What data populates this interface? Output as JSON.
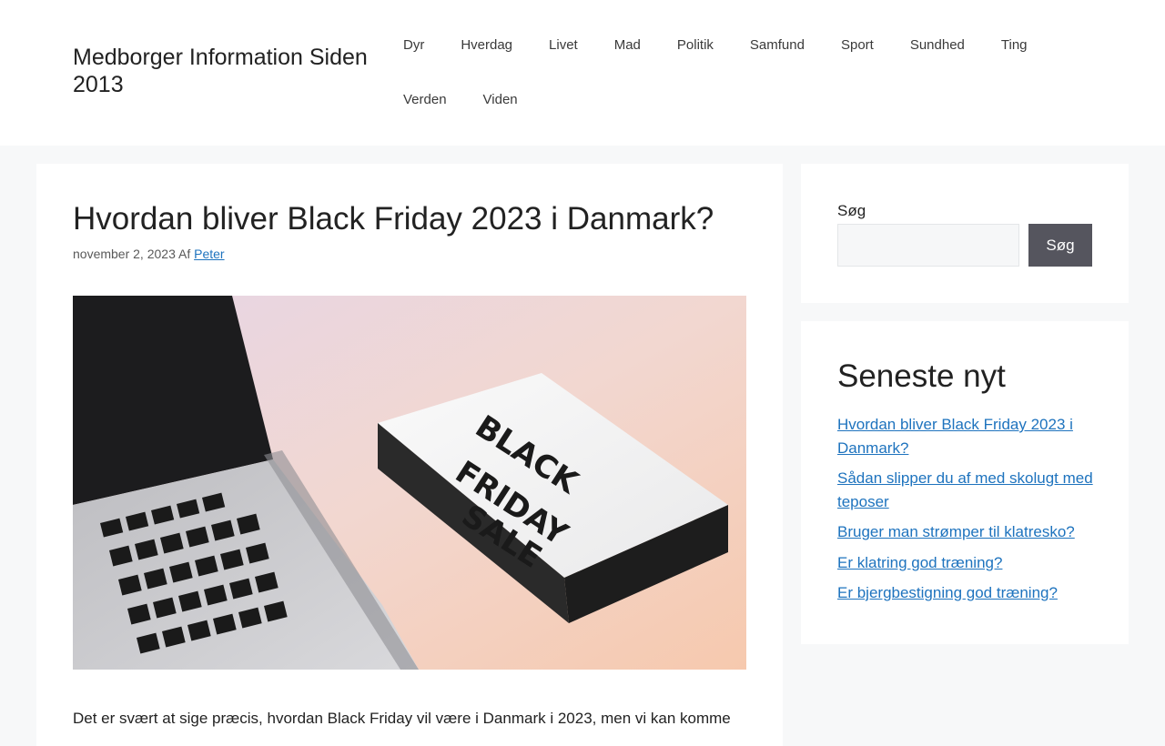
{
  "site": {
    "title": "Medborger Information Siden 2013"
  },
  "nav": {
    "items": [
      {
        "label": "Dyr"
      },
      {
        "label": "Hverdag"
      },
      {
        "label": "Livet"
      },
      {
        "label": "Mad"
      },
      {
        "label": "Politik"
      },
      {
        "label": "Samfund"
      },
      {
        "label": "Sport"
      },
      {
        "label": "Sundhed"
      },
      {
        "label": "Ting"
      },
      {
        "label": "Verden"
      },
      {
        "label": "Viden"
      }
    ]
  },
  "post": {
    "title": "Hvordan bliver Black Friday 2023 i Danmark?",
    "date": "november 2, 2023",
    "author_prefix": "Af",
    "author": "Peter",
    "image_text": [
      "BLACK",
      "FRIDAY",
      "SALE"
    ],
    "excerpt": "Det er svært at sige præcis, hvordan Black Friday vil være i Danmark i 2023, men vi kan komme"
  },
  "search": {
    "label": "Søg",
    "input_value": "",
    "button_label": "Søg"
  },
  "recent": {
    "title": "Seneste nyt",
    "items": [
      {
        "label": "Hvordan bliver Black Friday 2023 i Danmark?"
      },
      {
        "label": "Sådan slipper du af med skolugt med teposer"
      },
      {
        "label": "Bruger man strømper til klatresko?"
      },
      {
        "label": "Er klatring god træning?"
      },
      {
        "label": "Er bjergbestigning god træning?"
      }
    ]
  },
  "colors": {
    "link": "#1e73be",
    "button": "#55555e",
    "page_background": "#f7f8f9"
  }
}
